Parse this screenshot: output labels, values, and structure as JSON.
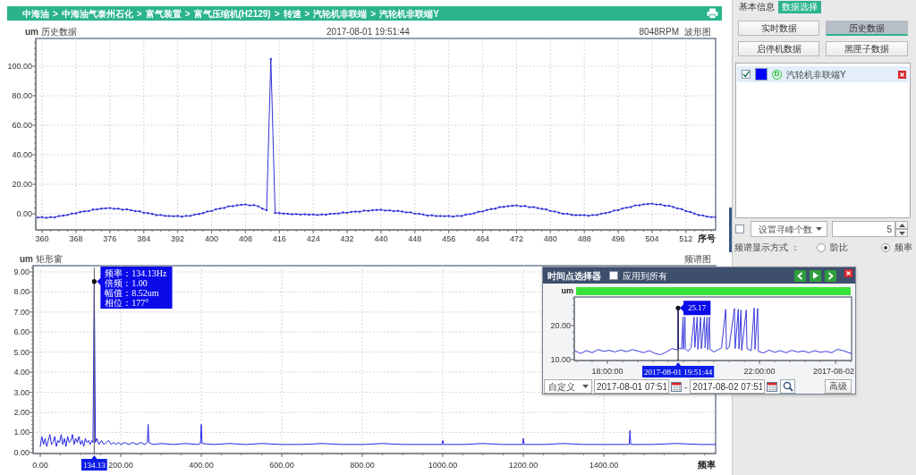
{
  "breadcrumb": {
    "items": [
      "中海油",
      "中海油气泰州石化",
      "富气装置",
      "富气压缩机(H2129)",
      "转速",
      "汽轮机非联端",
      "汽轮机非联端Y"
    ],
    "separator": ">"
  },
  "trend_chart": {
    "timestamp": "2017-08-01 19:51:44",
    "speed": "8048RPM",
    "view": "波形图",
    "chart_data": {
      "type": "line",
      "title": "历史数据",
      "ylabel": "um",
      "xlabel": "序号",
      "x": [
        359,
        360,
        361,
        362,
        363,
        364,
        365,
        366,
        367,
        368,
        369,
        370,
        371,
        372,
        373,
        374,
        375,
        376,
        377,
        378,
        379,
        380,
        381,
        382,
        383,
        384,
        385,
        386,
        387,
        388,
        389,
        390,
        391,
        392,
        393,
        394,
        395,
        396,
        397,
        398,
        399,
        400,
        401,
        402,
        403,
        404,
        405,
        406,
        407,
        408,
        409,
        410,
        411,
        412,
        413,
        414,
        415,
        416,
        417,
        418,
        419,
        420,
        421,
        422,
        423,
        424,
        425,
        426,
        427,
        428,
        429,
        430,
        431,
        432,
        433,
        434,
        435,
        436,
        437,
        438,
        439,
        440,
        441,
        442,
        443,
        444,
        445,
        446,
        447,
        448,
        449,
        450,
        451,
        452,
        453,
        454,
        455,
        456,
        457,
        458,
        459,
        460,
        461,
        462,
        463,
        464,
        465,
        466,
        467,
        468,
        469,
        470,
        471,
        472,
        473,
        474,
        475,
        476,
        477,
        478,
        479,
        480,
        481,
        482,
        483,
        484,
        485,
        486,
        487,
        488,
        489,
        490,
        491,
        492,
        493,
        494,
        495,
        496,
        497,
        498,
        499,
        500,
        501,
        502,
        503,
        504,
        505,
        506,
        507,
        508,
        509,
        510,
        511,
        512,
        513,
        514,
        515,
        516,
        517,
        518,
        519
      ],
      "values": [
        -2.5,
        -2.3,
        -2.7,
        -2.3,
        -2.4,
        -1.5,
        -1.2,
        -0.8,
        0.2,
        0.3,
        1.2,
        1.7,
        1.9,
        2.9,
        3.0,
        3.5,
        3.7,
        3.9,
        3.4,
        3.5,
        2.8,
        3.0,
        2.4,
        1.8,
        1.7,
        0.7,
        0.5,
        -0.1,
        -0.9,
        -0.8,
        -1.4,
        -1.5,
        -1.6,
        -1.5,
        -1.9,
        -1.4,
        -1.4,
        -0.5,
        -0.1,
        0.5,
        1.6,
        1.9,
        3.0,
        3.6,
        4.0,
        5.1,
        5.2,
        5.8,
        6.1,
        6.3,
        5.7,
        5.9,
        5.1,
        3.5,
        2.4,
        104.9,
        0.6,
        0.5,
        0.2,
        0.0,
        -0.3,
        -0.2,
        -0.5,
        -0.3,
        -0.6,
        -0.4,
        -0.8,
        -0.4,
        -0.6,
        0.0,
        0.1,
        0.2,
        0.9,
        0.7,
        1.3,
        1.5,
        1.4,
        2.2,
        2.0,
        2.4,
        2.6,
        2.7,
        2.2,
        2.3,
        1.8,
        2.0,
        1.5,
        1.0,
        1.0,
        0.1,
        0.0,
        -0.5,
        -1.2,
        -1.0,
        -1.5,
        -1.5,
        -1.6,
        -1.5,
        -1.9,
        -1.4,
        -1.5,
        -0.6,
        -0.2,
        0.3,
        1.4,
        1.6,
        2.6,
        3.2,
        3.5,
        4.6,
        4.7,
        5.2,
        5.5,
        5.7,
        5.1,
        5.3,
        4.5,
        4.6,
        3.9,
        3.3,
        3.0,
        1.9,
        1.6,
        0.8,
        0.0,
        0.0,
        -0.7,
        -0.9,
        -0.9,
        -0.9,
        -1.3,
        -0.8,
        -0.8,
        0.1,
        0.5,
        1.1,
        2.2,
        2.5,
        3.6,
        4.2,
        4.6,
        5.7,
        5.8,
        6.4,
        6.7,
        6.9,
        6.3,
        6.4,
        5.5,
        5.5,
        4.6,
        3.7,
        3.2,
        1.8,
        1.2,
        0.2,
        -0.9,
        -1.1,
        -1.9,
        -2.2,
        -2.3
      ],
      "xlim": [
        358.5,
        519
      ],
      "ylim": [
        -10.9,
        118.8
      ],
      "xticks": [
        360,
        368,
        376,
        384,
        392,
        400,
        408,
        416,
        424,
        432,
        440,
        448,
        456,
        464,
        472,
        480,
        488,
        496,
        504,
        512
      ],
      "yticks": [
        {
          "value": 0,
          "label": "0.00"
        },
        {
          "value": 20,
          "label": "20.00"
        },
        {
          "value": 40,
          "label": "40.00"
        },
        {
          "value": 60,
          "label": "60.00"
        },
        {
          "value": 80,
          "label": "80.00"
        },
        {
          "value": 100,
          "label": "100.00"
        }
      ],
      "grid": true
    }
  },
  "spectrum_chart": {
    "view": "频谱图",
    "tooltip": [
      "频率：134.13Hz",
      "倍频：1.00",
      "幅值：8.52um",
      "相位：177°"
    ],
    "chart_data": {
      "type": "line",
      "title": "矩形窗",
      "ylabel": "um",
      "xlabel": "频率",
      "x": [
        0,
        4,
        8,
        12,
        16,
        20,
        24,
        28,
        32,
        36,
        40,
        44,
        48,
        52,
        56,
        60,
        64,
        68,
        72,
        76,
        80,
        84,
        88,
        92,
        96,
        100,
        104,
        108,
        112,
        116,
        120,
        124,
        128,
        131,
        134.13,
        137,
        140,
        146,
        152,
        158,
        164,
        170,
        176,
        182,
        188,
        194,
        200,
        210,
        220,
        230,
        240,
        250,
        260,
        266,
        268,
        270,
        280,
        300,
        330,
        360,
        390,
        398,
        400,
        402,
        430,
        470,
        510,
        550,
        600,
        650,
        700,
        750,
        800,
        850,
        900,
        950,
        998,
        1000,
        1002,
        1050,
        1100,
        1150,
        1198,
        1200,
        1202,
        1250,
        1300,
        1350,
        1400,
        1463,
        1465,
        1467,
        1520,
        1580,
        1640,
        1677
      ],
      "values": [
        0.3,
        0.8,
        0.4,
        0.7,
        0.3,
        0.6,
        0.9,
        0.4,
        0.5,
        0.8,
        0.3,
        0.6,
        0.5,
        0.9,
        0.4,
        0.7,
        0.3,
        0.8,
        0.5,
        0.6,
        0.9,
        0.4,
        0.7,
        0.5,
        0.8,
        0.4,
        0.6,
        0.3,
        0.7,
        0.5,
        0.6,
        0.4,
        0.6,
        0.5,
        8.52,
        0.5,
        0.7,
        0.4,
        0.6,
        0.4,
        0.5,
        0.6,
        0.4,
        0.5,
        0.4,
        0.5,
        0.4,
        0.5,
        0.4,
        0.5,
        0.4,
        0.5,
        0.4,
        0.5,
        1.4,
        0.5,
        0.4,
        0.45,
        0.4,
        0.45,
        0.4,
        0.45,
        1.4,
        0.45,
        0.4,
        0.45,
        0.4,
        0.45,
        0.4,
        0.4,
        0.45,
        0.4,
        0.4,
        0.45,
        0.4,
        0.4,
        0.4,
        0.6,
        0.4,
        0.4,
        0.45,
        0.4,
        0.4,
        0.7,
        0.4,
        0.4,
        0.45,
        0.4,
        0.4,
        0.4,
        1.1,
        0.4,
        0.4,
        0.45,
        0.4,
        0.4
      ],
      "xlim": [
        -17.8,
        1677.8
      ],
      "ylim": [
        -0.05,
        9.31
      ],
      "xticks": [
        {
          "value": 0,
          "label": "0.00"
        },
        {
          "value": 200,
          "label": "200.00"
        },
        {
          "value": 400,
          "label": "400.00"
        },
        {
          "value": 600,
          "label": "600.00"
        },
        {
          "value": 800,
          "label": "800.00"
        },
        {
          "value": 1000,
          "label": "1000.00"
        },
        {
          "value": 1200,
          "label": "1200.00"
        },
        {
          "value": 1400,
          "label": "1400.00"
        }
      ],
      "yticks": [
        {
          "value": 0,
          "label": "0.00"
        },
        {
          "value": 1,
          "label": "1.00"
        },
        {
          "value": 2,
          "label": "2.00"
        },
        {
          "value": 3,
          "label": "3.00"
        },
        {
          "value": 4,
          "label": "4.00"
        },
        {
          "value": 5,
          "label": "5.00"
        },
        {
          "value": 6,
          "label": "6.00"
        },
        {
          "value": 7,
          "label": "7.00"
        },
        {
          "value": 8,
          "label": "8.00"
        },
        {
          "value": 9,
          "label": "9.00"
        }
      ],
      "grid": true,
      "ref_lines": [
        {
          "axis": "x",
          "value": 134.13,
          "label": "134.13"
        }
      ]
    }
  },
  "time_picker": {
    "title": "时间点选择器",
    "apply_all": {
      "label": "应用到所有",
      "checked": false
    },
    "cursor_time": "2017-08-01 19:51:44",
    "chart_data": {
      "type": "line",
      "ylabel": "um",
      "x": [
        17.15,
        17.3,
        17.45,
        17.6,
        17.75,
        17.9,
        18.05,
        18.2,
        18.35,
        18.5,
        18.65,
        18.8,
        18.95,
        19.1,
        19.25,
        19.4,
        19.55,
        19.7,
        19.85,
        19.86,
        19.87,
        19.95,
        19.99,
        20.0,
        20.04,
        20.05,
        20.12,
        20.2,
        20.28,
        20.3,
        20.36,
        20.38,
        20.45,
        20.47,
        20.55,
        20.57,
        20.62,
        20.64,
        20.68,
        20.7,
        20.8,
        20.9,
        21.0,
        21.11,
        21.13,
        21.2,
        21.34,
        21.36,
        21.44,
        21.46,
        21.51,
        21.53,
        21.65,
        21.67,
        21.78,
        21.86,
        21.88,
        21.95,
        21.97,
        22.1,
        22.25,
        22.4,
        22.55,
        22.7,
        22.85,
        23.0,
        23.15,
        23.3,
        23.45,
        23.6,
        23.75,
        23.9,
        24.05,
        24.2,
        24.35,
        24.42
      ],
      "values": [
        12.5,
        11.8,
        12.6,
        12.0,
        12.9,
        12.4,
        12.7,
        12.2,
        12.8,
        12.3,
        12.9,
        12.5,
        12.0,
        12.6,
        11.8,
        11.4,
        12.2,
        13.2,
        12.8,
        25.17,
        13.4,
        13.1,
        22.5,
        13.0,
        22.5,
        13.2,
        12.4,
        13.5,
        22.5,
        13.6,
        22.5,
        13.0,
        22.5,
        13.2,
        22.5,
        13.4,
        22.5,
        12.8,
        22.5,
        13.0,
        12.2,
        12.8,
        13.4,
        24.8,
        13.0,
        13.6,
        25.0,
        13.2,
        24.8,
        13.1,
        24.6,
        12.7,
        24.6,
        13.2,
        12.6,
        25.2,
        13.0,
        25.0,
        12.4,
        11.9,
        12.8,
        12.1,
        12.6,
        12.0,
        12.7,
        12.2,
        12.5,
        12.0,
        12.6,
        12.1,
        12.4,
        12.0,
        13.0,
        12.6,
        12.0,
        11.8
      ],
      "xlim": [
        17.13,
        24.42
      ],
      "ylim": [
        9.7,
        28.4
      ],
      "xticks": [
        {
          "value": 18,
          "label": "18:00:00"
        },
        {
          "value": 22,
          "label": "22:00:00"
        },
        {
          "value": 24,
          "label": "2017-08-02"
        }
      ],
      "yticks": [
        {
          "value": 10,
          "label": "10.00"
        },
        {
          "value": 20,
          "label": "20.00"
        }
      ],
      "ref_lines": [
        {
          "axis": "x",
          "value": 19.86
        }
      ],
      "annotations": [
        {
          "x": 19.86,
          "y": 25.17,
          "text": "25.17"
        }
      ]
    },
    "range": "自定义",
    "start": "2017-08-01 07:51",
    "range_separator": "-",
    "end": "2017-08-02 07:51",
    "advanced": "高级"
  },
  "side_panel": {
    "tabs": [
      {
        "label": "基本信息",
        "selected": false
      },
      {
        "label": "数据选择",
        "selected": true
      }
    ],
    "data_buttons": [
      {
        "label": "实时数据",
        "selected": false
      },
      {
        "label": "历史数据",
        "selected": true
      },
      {
        "label": "启停机数据",
        "selected": false
      },
      {
        "label": "黑匣子数据",
        "selected": false
      }
    ],
    "channels": [
      {
        "name": "汽轮机非联端Y",
        "checked": true,
        "color": "#0000ff",
        "badge": "D"
      }
    ],
    "peak_search": {
      "enabled": false,
      "mode": "设置寻峰个数",
      "count": "5"
    },
    "display_mode": {
      "label": "频谱显示方式 ：",
      "options": [
        {
          "label": "阶比",
          "selected": false
        },
        {
          "label": "频率",
          "selected": true
        }
      ]
    }
  }
}
